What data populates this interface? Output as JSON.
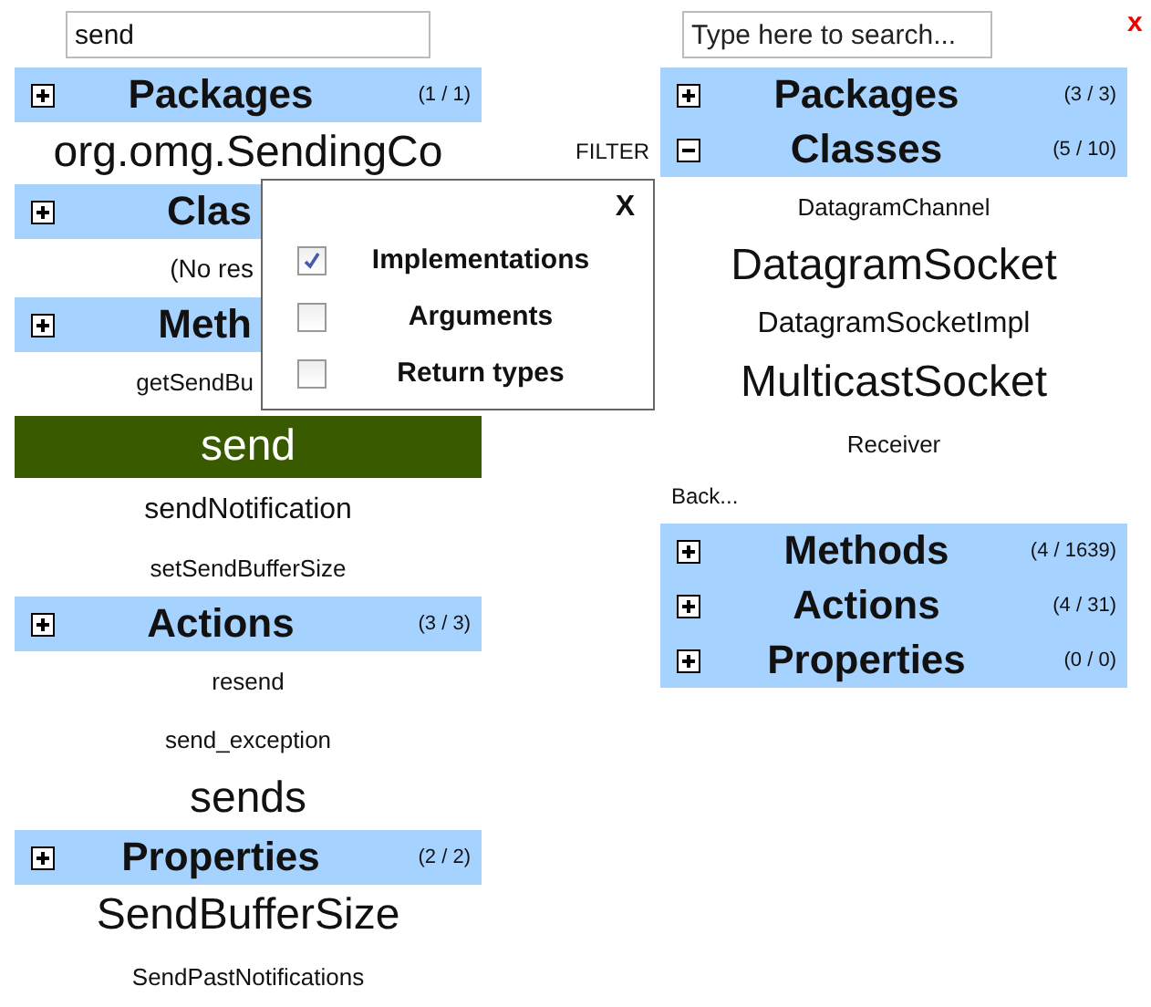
{
  "left_panel": {
    "search": {
      "value": "send"
    },
    "sections": [
      {
        "title": "Packages",
        "count": "(1 / 1)",
        "expanded": false,
        "items": [
          {
            "text": "org.omg.SendingCo",
            "kind": "large",
            "selected": false
          }
        ]
      },
      {
        "title": "Clas",
        "cut": true,
        "expanded": false,
        "items": [
          {
            "text": "(No res",
            "kind": "note",
            "cut": true,
            "selected": false
          }
        ]
      },
      {
        "title": "Meth",
        "cut": true,
        "expanded": false,
        "items": [
          {
            "text": "getSendBu",
            "kind": "small",
            "cut": true,
            "selected": false
          },
          {
            "text": "send",
            "kind": "large",
            "selected": true
          },
          {
            "text": "sendNotification",
            "kind": "medium",
            "selected": false
          },
          {
            "text": "setSendBufferSize",
            "kind": "small",
            "selected": false
          }
        ]
      },
      {
        "title": "Actions",
        "count": "(3 / 3)",
        "expanded": false,
        "items": [
          {
            "text": "resend",
            "kind": "small",
            "selected": false
          },
          {
            "text": "send_exception",
            "kind": "small",
            "selected": false
          },
          {
            "text": "sends",
            "kind": "large",
            "selected": false
          }
        ]
      },
      {
        "title": "Properties",
        "count": "(2 / 2)",
        "expanded": false,
        "items": [
          {
            "text": "SendBufferSize",
            "kind": "large",
            "selected": false
          },
          {
            "text": "SendPastNotifications",
            "kind": "small",
            "selected": false
          }
        ]
      }
    ]
  },
  "filter_label": "FILTER",
  "filter_popup": {
    "close": "X",
    "options": [
      {
        "label": "Implementations",
        "checked": true
      },
      {
        "label": "Arguments",
        "checked": false
      },
      {
        "label": "Return types",
        "checked": false
      }
    ]
  },
  "right_panel": {
    "search": {
      "placeholder": "Type here to search..."
    },
    "sections": [
      {
        "title": "Packages",
        "count": "(3 / 3)",
        "expanded": false
      },
      {
        "title": "Classes",
        "count": "(5 / 10)",
        "expanded": true,
        "items": [
          {
            "text": "DatagramChannel",
            "kind": "small",
            "selected": false
          },
          {
            "text": "DatagramSocket",
            "kind": "large",
            "selected": false
          },
          {
            "text": "DatagramSocketImpl",
            "kind": "medium",
            "selected": false
          },
          {
            "text": "MulticastSocket",
            "kind": "large",
            "selected": false
          },
          {
            "text": "Receiver",
            "kind": "small",
            "selected": false
          }
        ],
        "back": "Back..."
      },
      {
        "title": "Methods",
        "count": "(4 / 1639)",
        "expanded": false
      },
      {
        "title": "Actions",
        "count": "(4 / 31)",
        "expanded": false
      },
      {
        "title": "Properties",
        "count": "(0 / 0)",
        "expanded": false
      }
    ]
  },
  "close_all": "x"
}
